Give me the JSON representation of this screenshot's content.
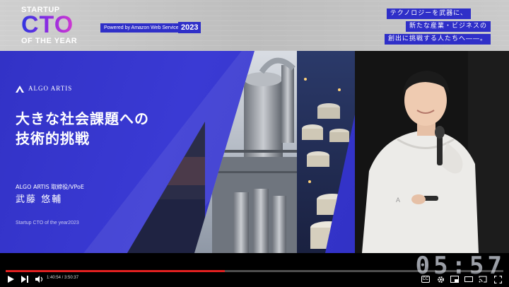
{
  "banner": {
    "logo_top": "STARTUP",
    "logo_main": "CTO",
    "logo_bottom": "OF THE YEAR",
    "powered_by": "Powered by Amazon Web Services",
    "year": "2023",
    "tagline_lines": [
      "テクノロジーを武器に、",
      "新たな産業・ビジネスの",
      "創出に挑戦する人たちへ――。"
    ]
  },
  "slide": {
    "brand": "ALGO ARTIS",
    "title": "大きな社会課題への\n技術的挑戦",
    "speaker_role": "ALGO ARTIS 取締役/VPoE",
    "speaker_name": "武藤 悠輔",
    "footer": "Startup CTO of the year2023"
  },
  "overlay": {
    "timer": "05:57"
  },
  "player": {
    "current_time": "1:40:54",
    "duration": "3:50:37",
    "time_text": "1:40:54 / 3:50:37",
    "progress_fraction": 0.44,
    "subtitles_label": "CC",
    "accent_color": "#e02020"
  },
  "icons": {
    "play": "play-icon",
    "next": "next-icon",
    "volume": "volume-icon",
    "settings": "gear-icon",
    "miniplayer": "miniplayer-icon",
    "theater": "theater-icon",
    "cast": "cast-icon",
    "fullscreen": "fullscreen-icon"
  }
}
